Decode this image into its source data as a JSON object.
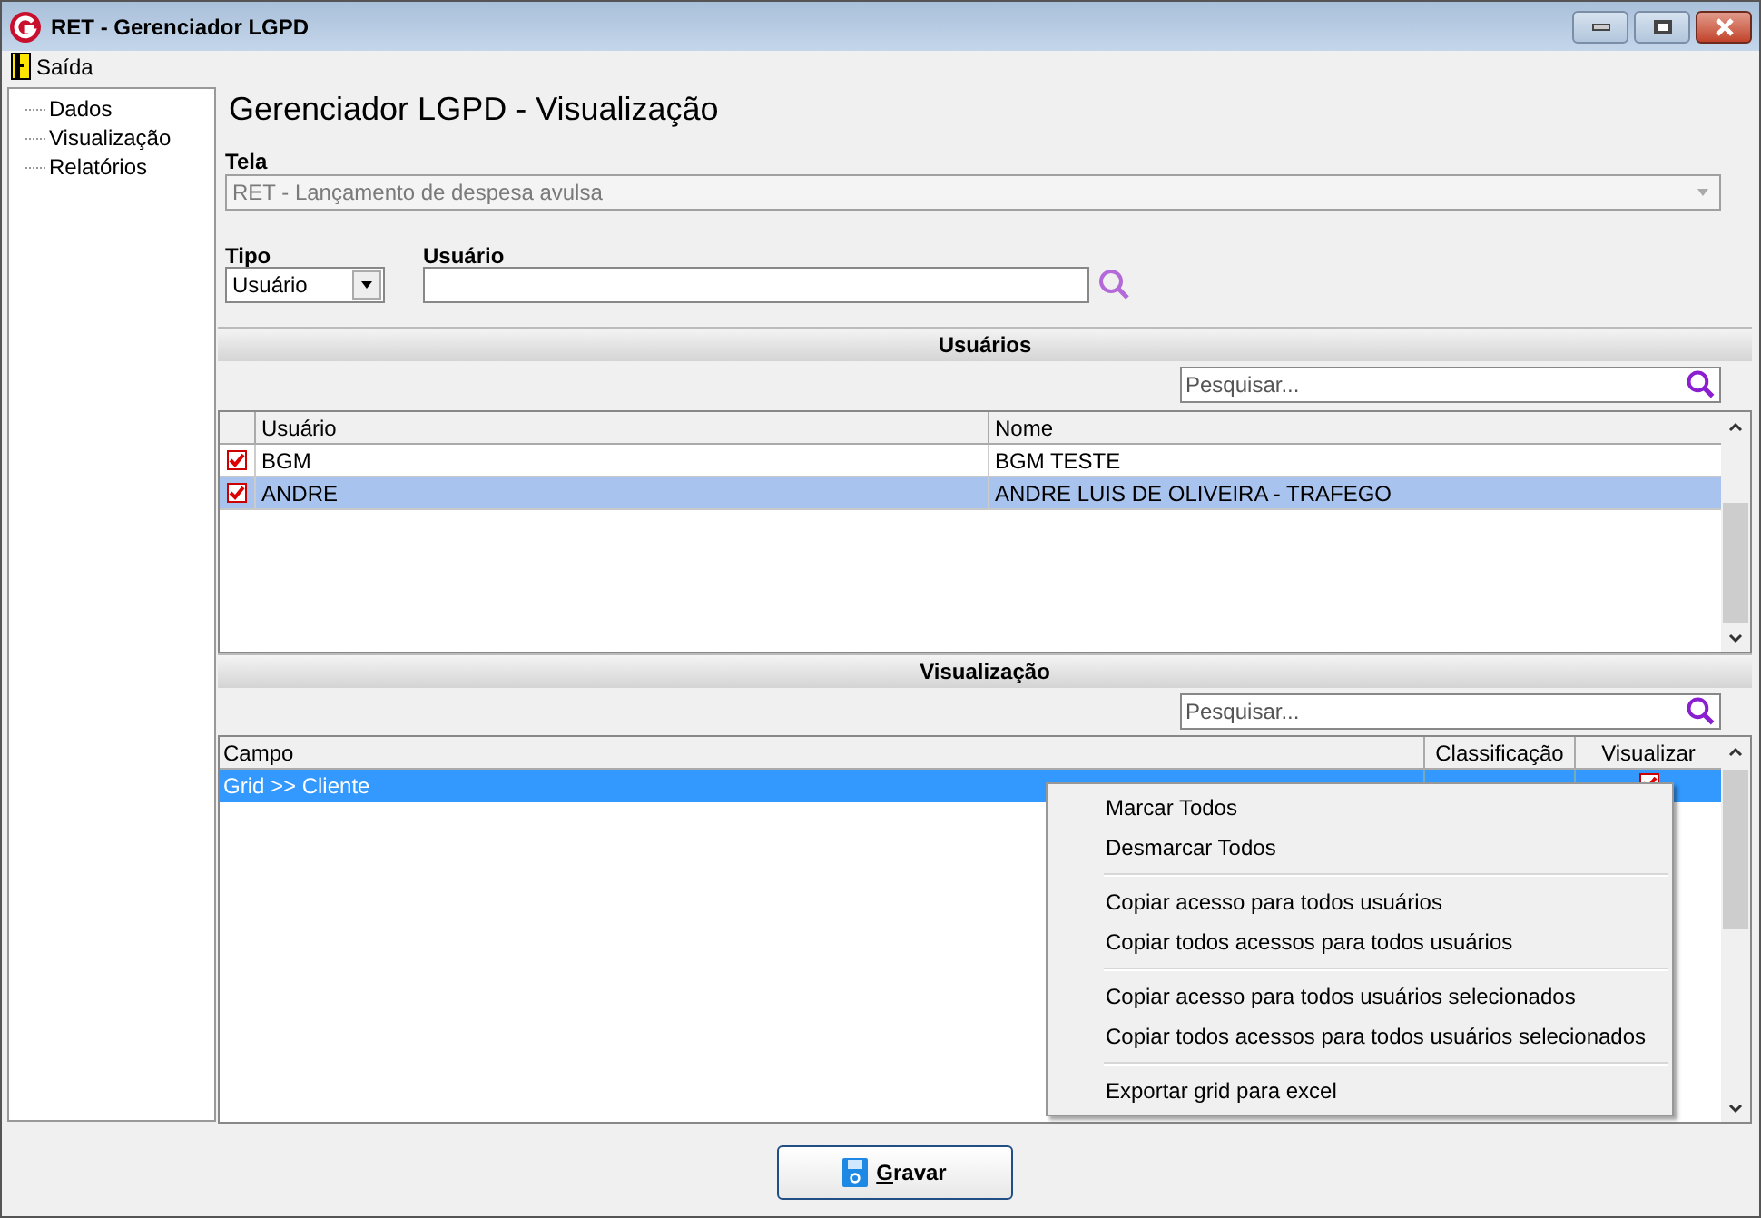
{
  "window": {
    "title": "RET - Gerenciador LGPD"
  },
  "menu": [
    {
      "label": "Saída"
    }
  ],
  "tree": [
    {
      "label": "Dados"
    },
    {
      "label": "Visualização"
    },
    {
      "label": "Relatórios"
    }
  ],
  "heading": "Gerenciador LGPD - Visualização",
  "tela": {
    "label": "Tela",
    "value": "RET - Lançamento de despesa avulsa",
    "disabled": true
  },
  "tipo": {
    "label": "Tipo",
    "value": "Usuário"
  },
  "usuario": {
    "label": "Usuário"
  },
  "usuarios": {
    "title": "Usuários",
    "search": {
      "placeholder": "Pesquisar..."
    },
    "columns": [
      "Usuário",
      "Nome"
    ],
    "rows": [
      {
        "checked": true,
        "selected": false,
        "cells": [
          "BGM",
          "BGM TESTE"
        ]
      },
      {
        "checked": true,
        "selected": true,
        "cells": [
          "ANDRE",
          "ANDRE LUIS DE OLIVEIRA - TRAFEGO"
        ]
      }
    ]
  },
  "visualizacao": {
    "title": "Visualização",
    "search": {
      "placeholder": "Pesquisar..."
    },
    "columns": [
      "Campo",
      "Classificação",
      "Visualizar"
    ],
    "rows": [
      {
        "selected": true,
        "cells": [
          "Grid >> Cliente"
        ],
        "visualizar": true
      }
    ]
  },
  "context_menu": {
    "groups": [
      [
        "Marcar Todos",
        "Desmarcar Todos"
      ],
      [
        "Copiar acesso para todos usuários",
        "Copiar todos acessos para todos usuários"
      ],
      [
        "Copiar acesso para todos usuários selecionados",
        "Copiar todos acessos para todos usuários selecionados"
      ],
      [
        "Exportar grid para excel"
      ]
    ]
  },
  "save_button": {
    "label": "Gravar"
  }
}
